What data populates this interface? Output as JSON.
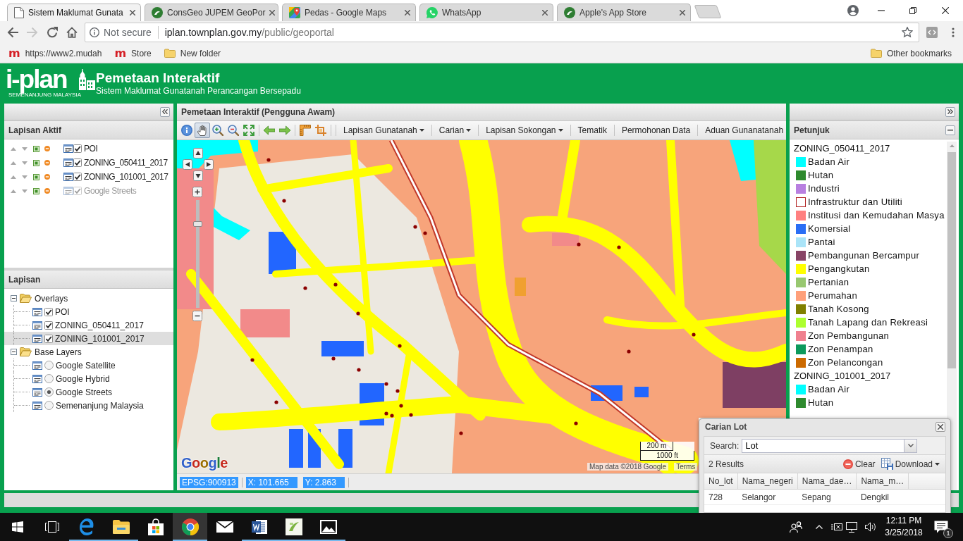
{
  "browser": {
    "tabs": [
      {
        "title": "Sistem Maklumat Gunata",
        "kind": "page",
        "selected": true
      },
      {
        "title": "ConsGeo JUPEM GeoPor",
        "kind": "emblem",
        "selected": false
      },
      {
        "title": "Pedas - Google Maps",
        "kind": "maps",
        "selected": false
      },
      {
        "title": "WhatsApp",
        "kind": "chat",
        "selected": false
      },
      {
        "title": "Apple's App Store",
        "kind": "emblem",
        "selected": false
      }
    ],
    "nav_buttons": [
      {
        "kind": "back",
        "disabled": false
      },
      {
        "kind": "forward",
        "disabled": true
      },
      {
        "kind": "reload",
        "disabled": false
      },
      {
        "kind": "home",
        "disabled": false
      }
    ],
    "address": {
      "security": "Not secure",
      "host": "iplan.townplan.gov.my",
      "path": "/public/geoportal"
    },
    "bookmarks": [
      {
        "kind": "site",
        "icon_text": "m",
        "label": "https://www2.mudah"
      },
      {
        "kind": "site",
        "icon_text": "m",
        "label": "Store"
      },
      {
        "kind": "folder",
        "label": "New folder"
      }
    ],
    "other_bookmarks": "Other bookmarks"
  },
  "header": {
    "logo_text": "i-plan",
    "logo_tagline": "SEMENANJUNG MALAYSIA",
    "title": "Pemetaan Interaktif",
    "subtitle": "Sistem Maklumat Gunatanah Perancangan Bersepadu"
  },
  "active_layers": {
    "title": "Lapisan Aktif",
    "rows": [
      {
        "name": "POI",
        "checked": true,
        "disabled": false
      },
      {
        "name": "ZONING_050411_2017",
        "checked": true,
        "disabled": false
      },
      {
        "name": "ZONING_101001_2017",
        "checked": true,
        "disabled": false
      },
      {
        "name": "Google Streets",
        "checked": true,
        "disabled": true
      }
    ]
  },
  "layers": {
    "title": "Lapisan",
    "groups": [
      {
        "label": "Overlays",
        "expanded": true,
        "children": [
          {
            "kind": "checkbox",
            "label": "POI",
            "checked": true,
            "selected": false
          },
          {
            "kind": "checkbox",
            "label": "ZONING_050411_2017",
            "checked": true,
            "selected": false
          },
          {
            "kind": "checkbox",
            "label": "ZONING_101001_2017",
            "checked": true,
            "selected": true
          }
        ]
      },
      {
        "label": "Base Layers",
        "expanded": true,
        "children": [
          {
            "kind": "radio",
            "label": "Google Satellite",
            "checked": false,
            "selected": false
          },
          {
            "kind": "radio",
            "label": "Google Hybrid",
            "checked": false,
            "selected": false
          },
          {
            "kind": "radio",
            "label": "Google Streets",
            "checked": true,
            "selected": false
          },
          {
            "kind": "radio",
            "label": "Semenanjung Malaysia",
            "checked": false,
            "selected": false
          }
        ]
      }
    ]
  },
  "map_panel": {
    "title": "Pemetaan Interaktif (Pengguna Awam)",
    "tools": [
      {
        "kind": "info",
        "selected": false
      },
      {
        "kind": "pan",
        "selected": true
      },
      {
        "kind": "zoom_in",
        "selected": false
      },
      {
        "kind": "zoom_out",
        "selected": false
      },
      {
        "kind": "full_extent",
        "selected": false
      },
      {
        "kind": "back",
        "selected": false
      },
      {
        "kind": "forward",
        "selected": false
      },
      {
        "kind": "measure_line",
        "selected": false
      },
      {
        "kind": "measure_area",
        "selected": false
      }
    ],
    "menus": [
      {
        "label": "Lapisan Gunatanah",
        "dropdown": true
      },
      {
        "label": "Carian",
        "dropdown": true
      },
      {
        "label": "Lapisan Sokongan",
        "dropdown": true
      },
      {
        "label": "Tematik",
        "dropdown": false
      },
      {
        "label": "Permohonan Data",
        "dropdown": false
      },
      {
        "label": "Aduan Gunanatanah",
        "dropdown": false
      }
    ],
    "zoom_slider": {
      "level": 0.79
    },
    "scale": {
      "metric": "200 m",
      "imperial": "1000 ft"
    },
    "provider_logo": "Google",
    "attribution": "Map data ©2018 Google",
    "terms": "Terms",
    "status": [
      {
        "text": "EPSG:900913",
        "selected": true
      },
      {
        "text": "X: 101.665",
        "selected": true
      },
      {
        "text": "Y: 2.863",
        "selected": true
      }
    ]
  },
  "legend": {
    "title": "Petunjuk",
    "groups": [
      {
        "title": "ZONING_050411_2017",
        "items": [
          {
            "label": "Badan Air",
            "kind": "fill",
            "color": "#00ffff"
          },
          {
            "label": "Hutan",
            "kind": "fill",
            "color": "#2e8a2e"
          },
          {
            "label": "Industri",
            "kind": "fill",
            "color": "#b87fe0"
          },
          {
            "label": "Infrastruktur dan Utiliti",
            "kind": "outline",
            "color": "#b22222"
          },
          {
            "label": "Institusi dan Kemudahan Masya",
            "kind": "fill",
            "color": "#ff8080"
          },
          {
            "label": "Komersial",
            "kind": "fill",
            "color": "#2a6ef5"
          },
          {
            "label": "Pantai",
            "kind": "fill",
            "color": "#aae4f8"
          },
          {
            "label": "Pembangunan Bercampur",
            "kind": "fill",
            "color": "#884466"
          },
          {
            "label": "Pengangkutan",
            "kind": "fill",
            "color": "#ffff00"
          },
          {
            "label": "Pertanian",
            "kind": "fill",
            "color": "#98c870"
          },
          {
            "label": "Perumahan",
            "kind": "fill",
            "color": "#ffa07a"
          },
          {
            "label": "Tanah Kosong",
            "kind": "fill",
            "color": "#808000"
          },
          {
            "label": "Tanah Lapang dan Rekreasi",
            "kind": "fill",
            "color": "#adff2f"
          },
          {
            "label": "Zon Pembangunan",
            "kind": "fill",
            "color": "#f0808f"
          },
          {
            "label": "Zon Penampan",
            "kind": "fill",
            "color": "#0c9a5c"
          },
          {
            "label": "Zon Pelancongan",
            "kind": "fill",
            "color": "#cc6a00"
          }
        ]
      },
      {
        "title": "ZONING_101001_2017",
        "items": [
          {
            "label": "Badan Air",
            "kind": "fill",
            "color": "#00ffff"
          },
          {
            "label": "Hutan",
            "kind": "fill",
            "color": "#2e8a2e"
          }
        ]
      }
    ]
  },
  "search_window": {
    "title": "Carian Lot",
    "search_label": "Search:",
    "search_value": "Lot",
    "result_count": "2 Results",
    "actions": [
      {
        "kind": "clear",
        "label": "Clear",
        "dropdown": false
      },
      {
        "kind": "download",
        "label": "Download",
        "dropdown": true
      }
    ],
    "columns": [
      "No_lot",
      "Nama_negeri",
      "Nama_dae…",
      "Nama_m…"
    ],
    "rows": [
      [
        "728",
        "Selangor",
        "Sepang",
        "Dengkil"
      ]
    ]
  },
  "taskbar": {
    "apps": [
      {
        "kind": "edge",
        "running": true,
        "selected": false
      },
      {
        "kind": "explorer",
        "running": true,
        "selected": false
      },
      {
        "kind": "store",
        "running": false,
        "selected": false
      },
      {
        "kind": "chrome",
        "running": true,
        "selected": true
      },
      {
        "kind": "mail",
        "running": false,
        "selected": false
      },
      {
        "kind": "word",
        "running": true,
        "selected": false
      },
      {
        "kind": "tile_app",
        "running": true,
        "selected": false
      },
      {
        "kind": "photos",
        "running": true,
        "selected": false
      }
    ],
    "time": "12:11 PM",
    "date": "3/25/2018",
    "notification_count": "1"
  }
}
